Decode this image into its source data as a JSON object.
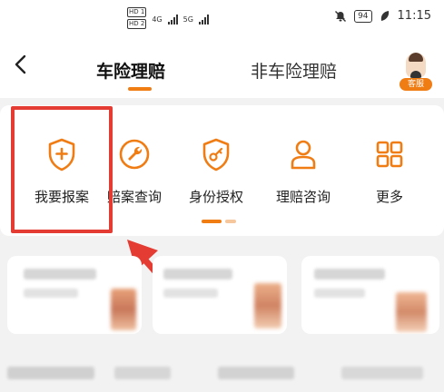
{
  "status_bar": {
    "hd1": "HD 1",
    "hd2": "HD 2",
    "net1": "4G",
    "net2": "5G",
    "battery": "94",
    "time": "11:15",
    "icons": [
      "mute-icon",
      "leaf-icon"
    ]
  },
  "nav": {
    "tabs": [
      {
        "label": "车险理赔",
        "active": true
      },
      {
        "label": "非车险理赔",
        "active": false
      }
    ],
    "customer_service_label": "客服"
  },
  "services": [
    {
      "label": "我要报案",
      "icon": "shield-plus-icon"
    },
    {
      "label": "赔案查询",
      "icon": "wrench-icon"
    },
    {
      "label": "身份授权",
      "icon": "shield-key-icon"
    },
    {
      "label": "理赔咨询",
      "icon": "person-icon"
    },
    {
      "label": "更多",
      "icon": "grid-icon"
    }
  ],
  "colors": {
    "accent": "#f07c14",
    "highlight": "#e43b32",
    "background": "#f2f2f2",
    "card": "#ffffff"
  }
}
